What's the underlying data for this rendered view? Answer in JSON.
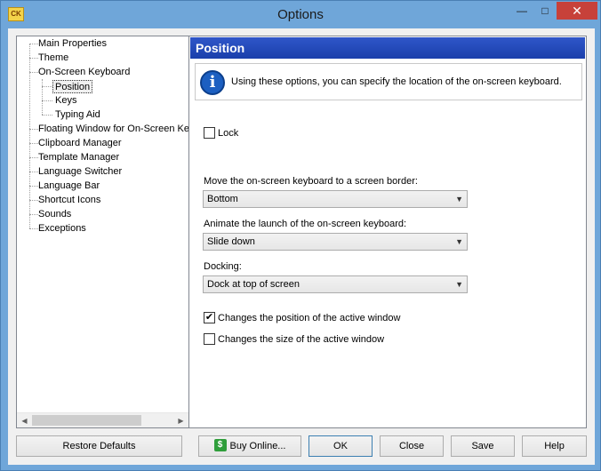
{
  "window": {
    "title": "Options",
    "app_icon_text": "CK",
    "minimize_glyph": "—",
    "maximize_glyph": "□",
    "close_glyph": "✕"
  },
  "tree": {
    "items": [
      {
        "label": "Main Properties"
      },
      {
        "label": "Theme"
      },
      {
        "label": "On-Screen Keyboard"
      },
      {
        "label": "Position"
      },
      {
        "label": "Keys"
      },
      {
        "label": "Typing Aid"
      },
      {
        "label": "Floating Window for On-Screen Ke"
      },
      {
        "label": "Clipboard Manager"
      },
      {
        "label": "Template Manager"
      },
      {
        "label": "Language Switcher"
      },
      {
        "label": "Language Bar"
      },
      {
        "label": "Shortcut Icons"
      },
      {
        "label": "Sounds"
      },
      {
        "label": "Exceptions"
      }
    ],
    "selected_index": 3
  },
  "panel": {
    "header": "Position",
    "info_text": "Using these options, you can specify the location of the on-screen keyboard.",
    "lock_label": "Lock",
    "lock_checked": false,
    "border_label": "Move the on-screen keyboard to a screen border:",
    "border_value": "Bottom",
    "animate_label": "Animate the launch of the on-screen keyboard:",
    "animate_value": "Slide down",
    "docking_label": "Docking:",
    "docking_value": "Dock at top of screen",
    "change_position_label": "Changes the position of the active window",
    "change_position_checked": true,
    "change_size_label": "Changes the size of the active window",
    "change_size_checked": false
  },
  "buttons": {
    "restore": "Restore Defaults",
    "buy": "Buy Online...",
    "ok": "OK",
    "close": "Close",
    "save": "Save",
    "help": "Help"
  },
  "glyphs": {
    "check": "✔",
    "dropdown": "▼",
    "scroll_left": "◀",
    "scroll_right": "▶",
    "info": "i",
    "dollar": "$"
  },
  "colors": {
    "header_blue": "#1a3fab",
    "title_bar": "#6fa6d9",
    "close_red": "#c7413a"
  }
}
